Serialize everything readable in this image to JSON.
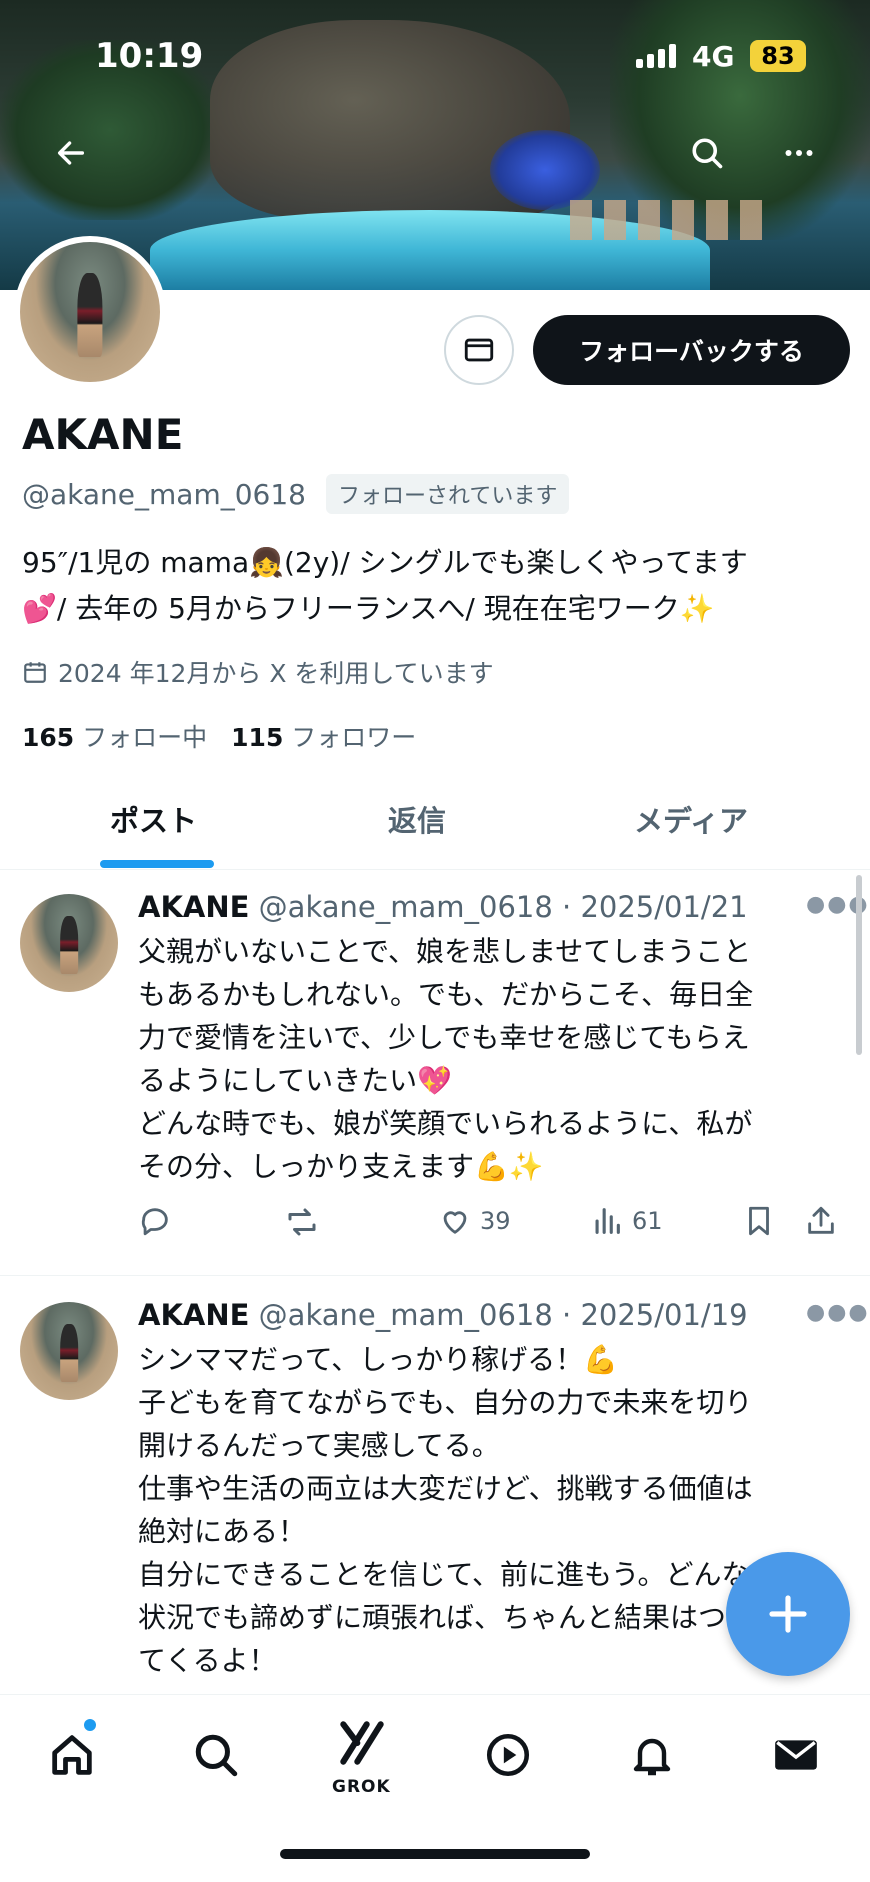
{
  "status_bar": {
    "time": "10:19",
    "network": "4G",
    "battery": "83"
  },
  "profile": {
    "name": "AKANE",
    "handle": "@akane_mam_0618",
    "follows_you": "フォローされています",
    "follow_back_label": "フォローバックする",
    "bio_line1": "95″/1児の mama👧(2y)/ シングルでも楽しくやってます",
    "bio_line2": "💕/ 去年の 5月からフリーランスへ/ 現在在宅ワーク✨",
    "joined": "2024 年12月から X を利用しています",
    "following_count": "165",
    "following_label": "フォロー中",
    "followers_count": "115",
    "followers_label": "フォロワー"
  },
  "tabs": [
    {
      "label": "ポスト",
      "active": true
    },
    {
      "label": "返信",
      "active": false
    },
    {
      "label": "メディア",
      "active": false
    }
  ],
  "posts": [
    {
      "name": "AKANE",
      "meta": "@akane_mam_0618 · 2025/01/21",
      "text": "父親がいないことで、娘を悲しませてしまうこと\nもあるかもしれない。でも、だからこそ、毎日全\n力で愛情を注いで、少しでも幸せを感じてもらえ\nるようにしていきたい💖\nどんな時でも、娘が笑顔でいられるように、私が\nその分、しっかり支えます💪✨",
      "likes": "39",
      "views": "61"
    },
    {
      "name": "AKANE",
      "meta": "@akane_mam_0618 · 2025/01/19",
      "text": "シンママだって、しっかり稼げる！💪\n子どもを育てながらでも、自分の力で未来を切り\n開けるんだって実感してる。\n仕事や生活の両立は大変だけど、挑戦する価値は\n絶対にある！\n自分にできることを信じて、前に進もう。どんな\n状況でも諦めずに頑張れば、ちゃんと結果はつい\nてくるよ！"
    }
  ],
  "nav": {
    "grok_label": "GROK"
  },
  "colors": {
    "accent": "#1d9bf0",
    "fab": "#4a99e9",
    "text": "#0f1419",
    "muted": "#536471"
  }
}
